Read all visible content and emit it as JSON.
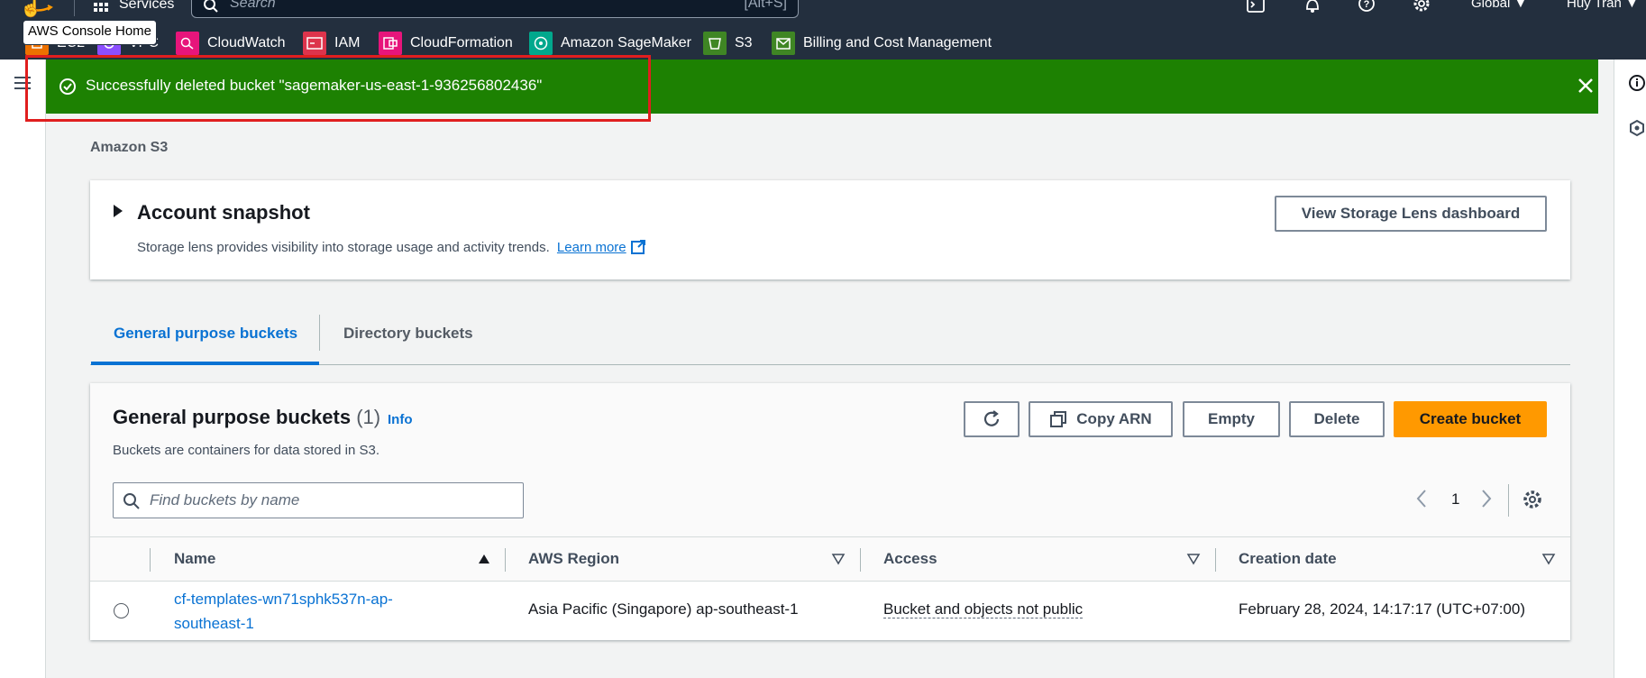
{
  "topnav": {
    "services_label": "Services",
    "search_placeholder": "Search",
    "search_shortcut": "[Alt+S]",
    "region_label": "Global",
    "user_label": "Huy Tran",
    "tooltip": "AWS Console Home"
  },
  "favorites": [
    {
      "label": "EC2",
      "color": "#ed7100",
      "icon": "ec2-icon"
    },
    {
      "label": "VPC",
      "color": "#8c4fff",
      "icon": "vpc-icon"
    },
    {
      "label": "CloudWatch",
      "color": "#e7157b",
      "icon": "cloudwatch-icon"
    },
    {
      "label": "IAM",
      "color": "#dd344c",
      "icon": "iam-icon"
    },
    {
      "label": "CloudFormation",
      "color": "#e7157b",
      "icon": "cloudformation-icon"
    },
    {
      "label": "Amazon SageMaker",
      "color": "#01a88d",
      "icon": "sagemaker-icon"
    },
    {
      "label": "S3",
      "color": "#3f8624",
      "icon": "s3-icon"
    },
    {
      "label": "Billing and Cost Management",
      "color": "#3f8624",
      "icon": "billing-icon"
    }
  ],
  "flash": {
    "message": "Successfully deleted bucket \"sagemaker-us-east-1-936256802436\"",
    "color": "#1d8102"
  },
  "breadcrumb": "Amazon S3",
  "snapshot": {
    "title": "Account snapshot",
    "description": "Storage lens provides visibility into storage usage and activity trends.",
    "learn_more": "Learn more",
    "button": "View Storage Lens dashboard"
  },
  "tabs": [
    {
      "label": "General purpose buckets",
      "active": true
    },
    {
      "label": "Directory buckets",
      "active": false
    }
  ],
  "buckets": {
    "title": "General purpose buckets",
    "count": "(1)",
    "info": "Info",
    "subtitle": "Buckets are containers for data stored in S3.",
    "actions": {
      "copy_arn": "Copy ARN",
      "empty": "Empty",
      "delete": "Delete",
      "create": "Create bucket"
    },
    "search_placeholder": "Find buckets by name",
    "page": "1",
    "columns": [
      "Name",
      "AWS Region",
      "Access",
      "Creation date"
    ],
    "rows": [
      {
        "name": "cf-templates-wn71sphk537n-ap-southeast-1",
        "region": "Asia Pacific (Singapore) ap-southeast-1",
        "access": "Bucket and objects not public",
        "created": "February 28, 2024, 14:17:17 (UTC+07:00)"
      }
    ]
  },
  "colors": {
    "nav_bg": "#232f3e",
    "link": "#0972d3",
    "primary": "#ff9900"
  }
}
